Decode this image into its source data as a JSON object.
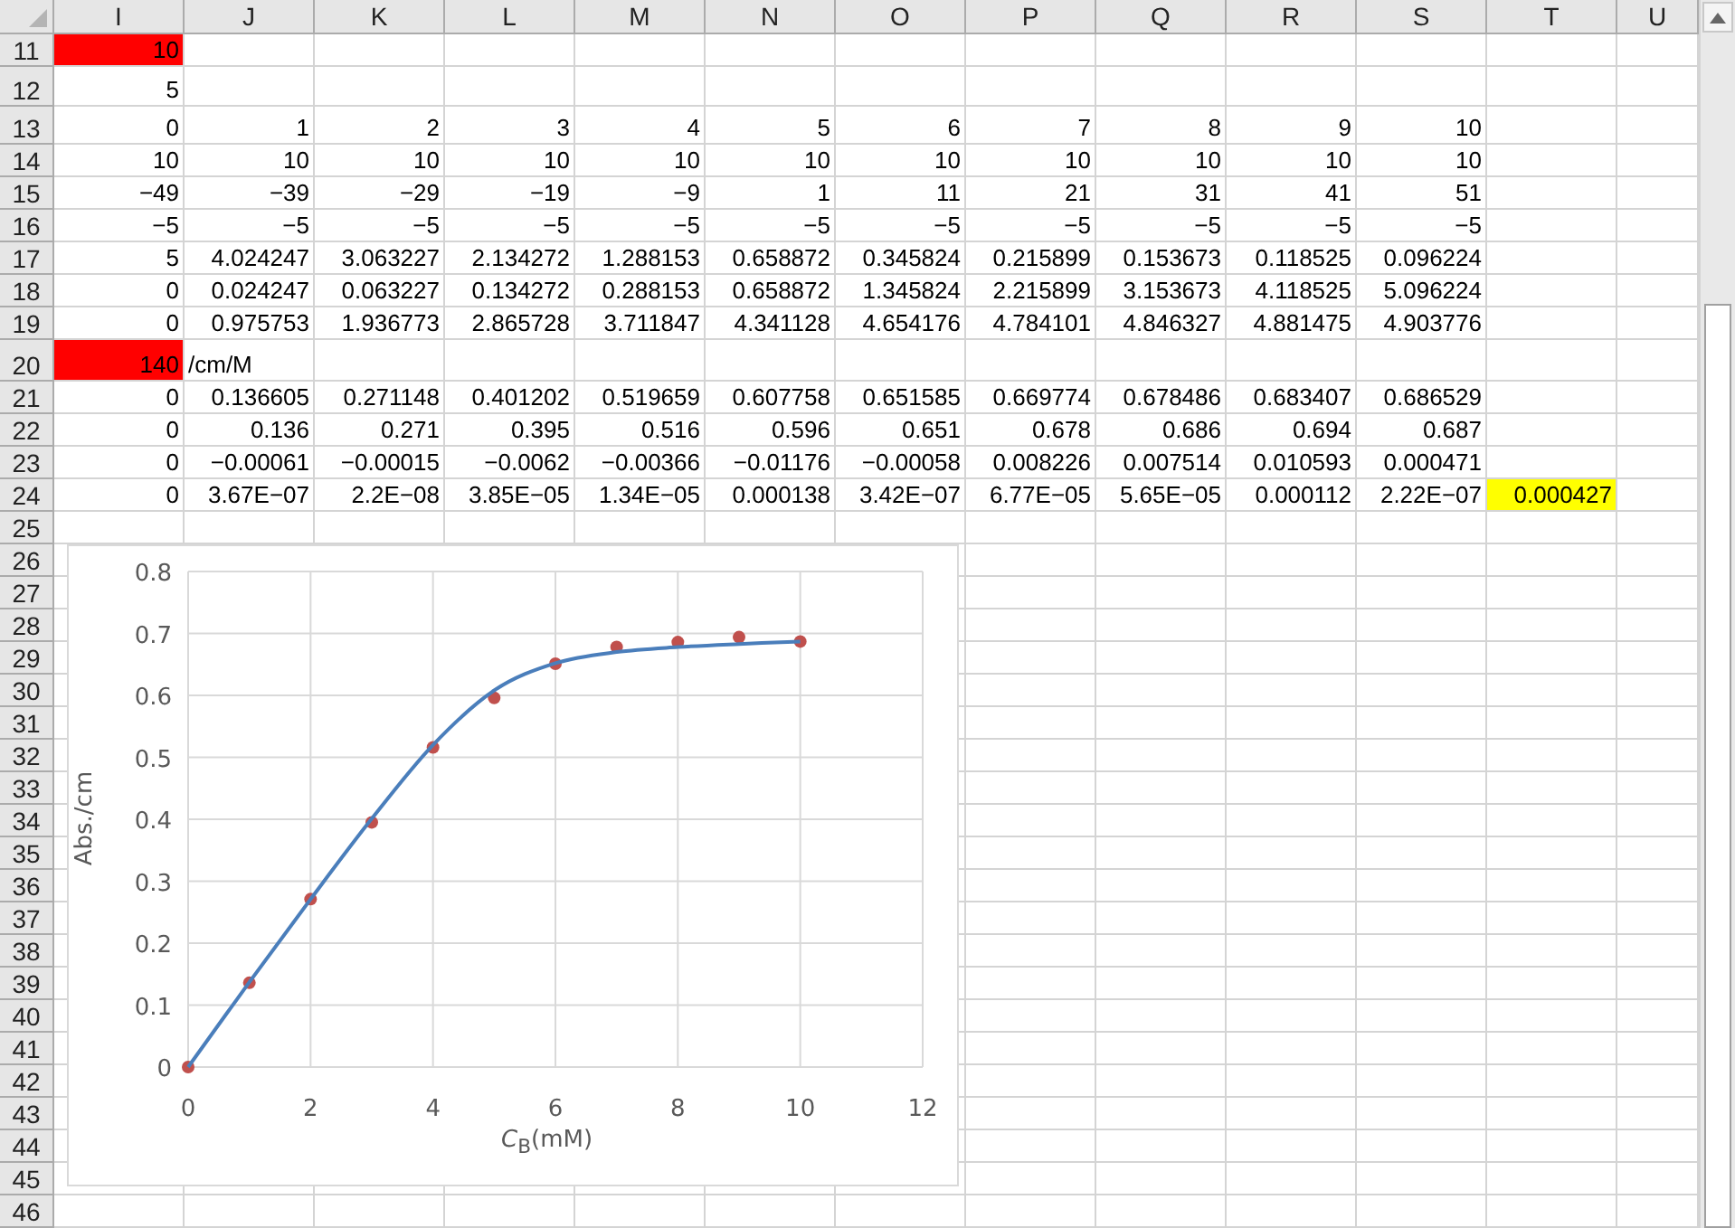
{
  "sheet": {
    "columns": [
      "I",
      "J",
      "K",
      "L",
      "M",
      "N",
      "O",
      "P",
      "Q",
      "R",
      "S",
      "T",
      "U"
    ],
    "rows": [
      {
        "number": "11",
        "cells": [
          {
            "text": "10",
            "color": "#ff0000"
          }
        ]
      },
      {
        "number": "12",
        "cells": [
          {
            "text": "5"
          }
        ]
      },
      {
        "number": "13",
        "cells": [
          {
            "text": "0"
          },
          {
            "text": "1"
          },
          {
            "text": "2"
          },
          {
            "text": "3"
          },
          {
            "text": "4"
          },
          {
            "text": "5"
          },
          {
            "text": "6"
          },
          {
            "text": "7"
          },
          {
            "text": "8"
          },
          {
            "text": "9"
          },
          {
            "text": "10"
          }
        ]
      },
      {
        "number": "14",
        "cells": [
          {
            "text": "10"
          },
          {
            "text": "10"
          },
          {
            "text": "10"
          },
          {
            "text": "10"
          },
          {
            "text": "10"
          },
          {
            "text": "10"
          },
          {
            "text": "10"
          },
          {
            "text": "10"
          },
          {
            "text": "10"
          },
          {
            "text": "10"
          },
          {
            "text": "10"
          }
        ]
      },
      {
        "number": "15",
        "cells": [
          {
            "text": "−49"
          },
          {
            "text": "−39"
          },
          {
            "text": "−29"
          },
          {
            "text": "−19"
          },
          {
            "text": "−9"
          },
          {
            "text": "1"
          },
          {
            "text": "11"
          },
          {
            "text": "21"
          },
          {
            "text": "31"
          },
          {
            "text": "41"
          },
          {
            "text": "51"
          }
        ]
      },
      {
        "number": "16",
        "cells": [
          {
            "text": "−5"
          },
          {
            "text": "−5"
          },
          {
            "text": "−5"
          },
          {
            "text": "−5"
          },
          {
            "text": "−5"
          },
          {
            "text": "−5"
          },
          {
            "text": "−5"
          },
          {
            "text": "−5"
          },
          {
            "text": "−5"
          },
          {
            "text": "−5"
          },
          {
            "text": "−5"
          }
        ]
      },
      {
        "number": "17",
        "cells": [
          {
            "text": "5"
          },
          {
            "text": "4.024247"
          },
          {
            "text": "3.063227"
          },
          {
            "text": "2.134272"
          },
          {
            "text": "1.288153"
          },
          {
            "text": "0.658872"
          },
          {
            "text": "0.345824"
          },
          {
            "text": "0.215899"
          },
          {
            "text": "0.153673"
          },
          {
            "text": "0.118525"
          },
          {
            "text": "0.096224"
          }
        ]
      },
      {
        "number": "18",
        "cells": [
          {
            "text": "0"
          },
          {
            "text": "0.024247"
          },
          {
            "text": "0.063227"
          },
          {
            "text": "0.134272"
          },
          {
            "text": "0.288153"
          },
          {
            "text": "0.658872"
          },
          {
            "text": "1.345824"
          },
          {
            "text": "2.215899"
          },
          {
            "text": "3.153673"
          },
          {
            "text": "4.118525"
          },
          {
            "text": "5.096224"
          }
        ]
      },
      {
        "number": "19",
        "cells": [
          {
            "text": "0"
          },
          {
            "text": "0.975753"
          },
          {
            "text": "1.936773"
          },
          {
            "text": "2.865728"
          },
          {
            "text": "3.711847"
          },
          {
            "text": "4.341128"
          },
          {
            "text": "4.654176"
          },
          {
            "text": "4.784101"
          },
          {
            "text": "4.846327"
          },
          {
            "text": "4.881475"
          },
          {
            "text": "4.903776"
          }
        ]
      },
      {
        "number": "20",
        "cells": [
          {
            "text": "140",
            "color": "#ff0000"
          },
          {
            "text": "/cm/M",
            "kind": "label"
          }
        ]
      },
      {
        "number": "21",
        "cells": [
          {
            "text": "0"
          },
          {
            "text": "0.136605"
          },
          {
            "text": "0.271148"
          },
          {
            "text": "0.401202"
          },
          {
            "text": "0.519659"
          },
          {
            "text": "0.607758"
          },
          {
            "text": "0.651585"
          },
          {
            "text": "0.669774"
          },
          {
            "text": "0.678486"
          },
          {
            "text": "0.683407"
          },
          {
            "text": "0.686529"
          }
        ]
      },
      {
        "number": "22",
        "cells": [
          {
            "text": "0"
          },
          {
            "text": "0.136"
          },
          {
            "text": "0.271"
          },
          {
            "text": "0.395"
          },
          {
            "text": "0.516"
          },
          {
            "text": "0.596"
          },
          {
            "text": "0.651"
          },
          {
            "text": "0.678"
          },
          {
            "text": "0.686"
          },
          {
            "text": "0.694"
          },
          {
            "text": "0.687"
          }
        ]
      },
      {
        "number": "23",
        "cells": [
          {
            "text": "0"
          },
          {
            "text": "−0.00061"
          },
          {
            "text": "−0.00015"
          },
          {
            "text": "−0.0062"
          },
          {
            "text": "−0.00366"
          },
          {
            "text": "−0.01176"
          },
          {
            "text": "−0.00058"
          },
          {
            "text": "0.008226"
          },
          {
            "text": "0.007514"
          },
          {
            "text": "0.010593"
          },
          {
            "text": "0.000471"
          }
        ]
      },
      {
        "number": "24",
        "cells": [
          {
            "text": "0"
          },
          {
            "text": "3.67E−07"
          },
          {
            "text": "2.2E−08"
          },
          {
            "text": "3.85E−05"
          },
          {
            "text": "1.34E−05"
          },
          {
            "text": "0.000138"
          },
          {
            "text": "3.42E−07"
          },
          {
            "text": "6.77E−05"
          },
          {
            "text": "5.65E−05"
          },
          {
            "text": "0.000112"
          },
          {
            "text": "2.22E−07"
          },
          {
            "text": "0.000427",
            "color": "#ffff00"
          }
        ]
      },
      {
        "number": "25"
      },
      {
        "number": "26"
      },
      {
        "number": "27"
      },
      {
        "number": "28"
      },
      {
        "number": "29"
      },
      {
        "number": "30"
      },
      {
        "number": "31"
      },
      {
        "number": "32"
      },
      {
        "number": "33"
      },
      {
        "number": "34"
      },
      {
        "number": "35"
      },
      {
        "number": "36"
      },
      {
        "number": "37"
      },
      {
        "number": "38"
      },
      {
        "number": "39"
      },
      {
        "number": "40"
      },
      {
        "number": "41"
      },
      {
        "number": "42"
      },
      {
        "number": "43"
      },
      {
        "number": "44"
      },
      {
        "number": "45"
      },
      {
        "number": "46"
      }
    ]
  },
  "chart": {
    "chart_data": {
      "type": "scatter",
      "xlabel": "*C*$_{B}$(mM)",
      "ylabel": "Abs./cm",
      "x": [
        0,
        1,
        2,
        3,
        4,
        5,
        6,
        7,
        8,
        9,
        10
      ],
      "series": [
        {
          "type": "scatter",
          "color": "#c0504d",
          "values": [
            0,
            0.136,
            0.271,
            0.395,
            0.516,
            0.596,
            0.651,
            0.678,
            0.686,
            0.694,
            0.687
          ]
        },
        {
          "type": "line",
          "color": "#4a7ebb",
          "values": [
            0,
            0.137,
            0.271,
            0.401,
            0.52,
            0.608,
            0.652,
            0.67,
            0.678,
            0.683,
            0.687
          ]
        }
      ],
      "grid": true,
      "xlim": [
        0,
        12
      ],
      "ylim": [
        0,
        0.8
      ],
      "xticks": [
        {
          "value": 0,
          "label": "0"
        },
        {
          "value": 2,
          "label": "2"
        },
        {
          "value": 4,
          "label": "4"
        },
        {
          "value": 6,
          "label": "6"
        },
        {
          "value": 8,
          "label": "8"
        },
        {
          "value": 10,
          "label": "10"
        },
        {
          "value": 12,
          "label": "12"
        }
      ],
      "yticks": [
        {
          "value": 0,
          "label": "0"
        },
        {
          "value": 0.1,
          "label": "0.1"
        },
        {
          "value": 0.2,
          "label": "0.2"
        },
        {
          "value": 0.3,
          "label": "0.3"
        },
        {
          "value": 0.4,
          "label": "0.4"
        },
        {
          "value": 0.5,
          "label": "0.5"
        },
        {
          "value": 0.6,
          "label": "0.6"
        },
        {
          "value": 0.7,
          "label": "0.7"
        },
        {
          "value": 0.8,
          "label": "0.8"
        }
      ]
    }
  }
}
